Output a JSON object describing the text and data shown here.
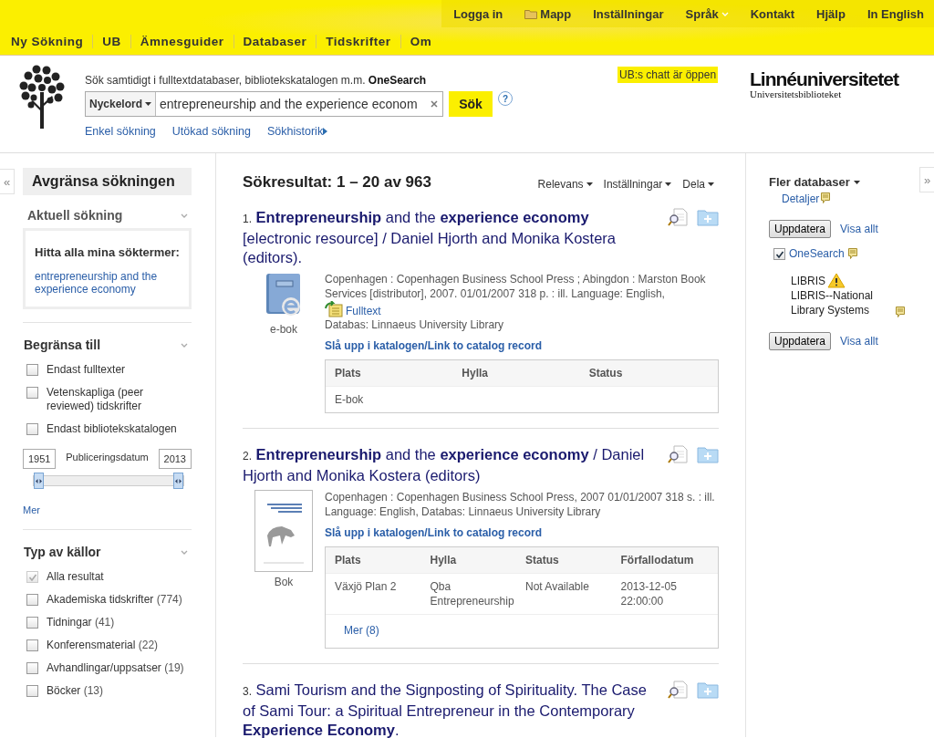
{
  "top_links": [
    {
      "label": "Logga in",
      "kind": "plain"
    },
    {
      "label": "Mapp",
      "kind": "folder"
    },
    {
      "label": "Inställningar",
      "kind": "plain"
    },
    {
      "label": "Språk",
      "kind": "dropdown"
    },
    {
      "label": "Kontakt",
      "kind": "plain"
    },
    {
      "label": "Hjälp",
      "kind": "plain"
    },
    {
      "label": "In English",
      "kind": "plain"
    }
  ],
  "nav": [
    "Ny Sökning",
    "UB",
    "Ämnesguider",
    "Databaser",
    "Tidskrifter",
    "Om"
  ],
  "search": {
    "intro": "Sök samtidigt i fulltextdatabaser, bibliotekskatalogen m.m. **OneSearch**",
    "field_type": "Nyckelord",
    "value": "entrepreneurship and the experience econom",
    "button": "Sök",
    "help": "?",
    "links": [
      "Enkel sökning",
      "Utökad sökning",
      "Sökhistorik"
    ]
  },
  "chat_notice": "UB:s chatt är öppen",
  "brand": {
    "name": "Linnéuniversitetet",
    "sub": "Universitetsbiblioteket"
  },
  "left": {
    "collapse": "«",
    "title": "Avgränsa sökningen",
    "current": {
      "heading": "Aktuell sökning",
      "label": "Hitta alla mina söktermer:",
      "term": "entrepreneurship and the experience economy"
    },
    "limit": {
      "heading": "Begränsa till",
      "options": [
        {
          "label": "Endast fulltexter",
          "checked": false,
          "disabled": false
        },
        {
          "label": "Vetenskapliga (peer reviewed) tidskrifter",
          "checked": false,
          "disabled": false
        },
        {
          "label": "Endast bibliotekskatalogen",
          "checked": false,
          "disabled": false
        }
      ],
      "date_from": "1951",
      "date_label": "Publiceringsdatum",
      "date_to": "2013",
      "handles": [
        {
          "level": 0
        },
        {
          "level": 1
        }
      ],
      "more": "Mer"
    },
    "sources": {
      "heading": "Typ av källor",
      "options": [
        {
          "label": "Alla resultat",
          "checked": true,
          "disabled": true
        },
        {
          "label": "Akademiska tidskrifter",
          "count": "(774)",
          "checked": false,
          "disabled": false
        },
        {
          "label": "Tidningar",
          "count": "(41)",
          "checked": false,
          "disabled": false
        },
        {
          "label": "Konferensmaterial",
          "count": "(22)",
          "checked": false,
          "disabled": false
        },
        {
          "label": "Avhandlingar/uppsatser",
          "count": "(19)",
          "checked": false,
          "disabled": false
        },
        {
          "label": "Böcker",
          "count": "(13)",
          "checked": false,
          "disabled": false
        }
      ]
    }
  },
  "results_header": {
    "label": "Sökresultat:",
    "range": "1 – 20 av 963",
    "menus": [
      "Relevans",
      "Inställningar",
      "Dela"
    ]
  },
  "results": [
    {
      "number": "1.",
      "title": "**Entrepreneurship** and the **experience economy** [electronic resource] / Daniel Hjorth and Monika Kostera (editors).",
      "kind": "ebook",
      "type_label": "e-bok",
      "details": "Copenhagen : Copenhagen Business School Press ; Abingdon : Marston Book Services [distributor], 2007. 01/01/2007 318 p. : ill. Language: English,",
      "fulltext": "Fulltext",
      "database": "Databas: Linnaeus University Library",
      "catalog_link": "Slå upp i katalogen/Link to catalog record",
      "holdings": {
        "columns": [
          "Plats",
          "Hylla",
          "Status"
        ],
        "rows": [
          [
            "E-bok",
            "",
            ""
          ]
        ]
      }
    },
    {
      "number": "2.",
      "title": "**Entrepreneurship** and the **experience economy** / Daniel Hjorth and Monika Kostera (editors)",
      "kind": "book",
      "type_label": "Bok",
      "details": "Copenhagen : Copenhagen Business School Press, 2007 01/01/2007 318 s. : ill. Language: English, Databas: Linnaeus University Library",
      "catalog_link": "Slå upp i katalogen/Link to catalog record",
      "holdings": {
        "columns": [
          "Plats",
          "Hylla",
          "Status",
          "Förfallodatum"
        ],
        "rows": [
          [
            "Växjö Plan 2",
            "Qba Entrepreneurship",
            "Not Available",
            "2013-12-05 22:00:00"
          ]
        ],
        "more": "Mer (8)"
      }
    },
    {
      "number": "3.",
      "title": "Sami Tourism and the Signposting of Spirituality. The Case of Sami Tour: a Spiritual Entrepreneur in the Contemporary **Experience Economy**.",
      "kind": "article"
    }
  ],
  "right": {
    "expand": "»",
    "title": "Fler databaser",
    "details": "Detaljer",
    "update": "Uppdatera",
    "show_all": "Visa allt",
    "databases": [
      {
        "name": "OneSearch",
        "kind": "checkbox",
        "checked": true
      },
      {
        "name": "LIBRIS",
        "subtitle": "LIBRIS--National Library Systems",
        "kind": "warning"
      }
    ],
    "update_2": "Uppdatera",
    "show_all_2": "Visa allt"
  }
}
